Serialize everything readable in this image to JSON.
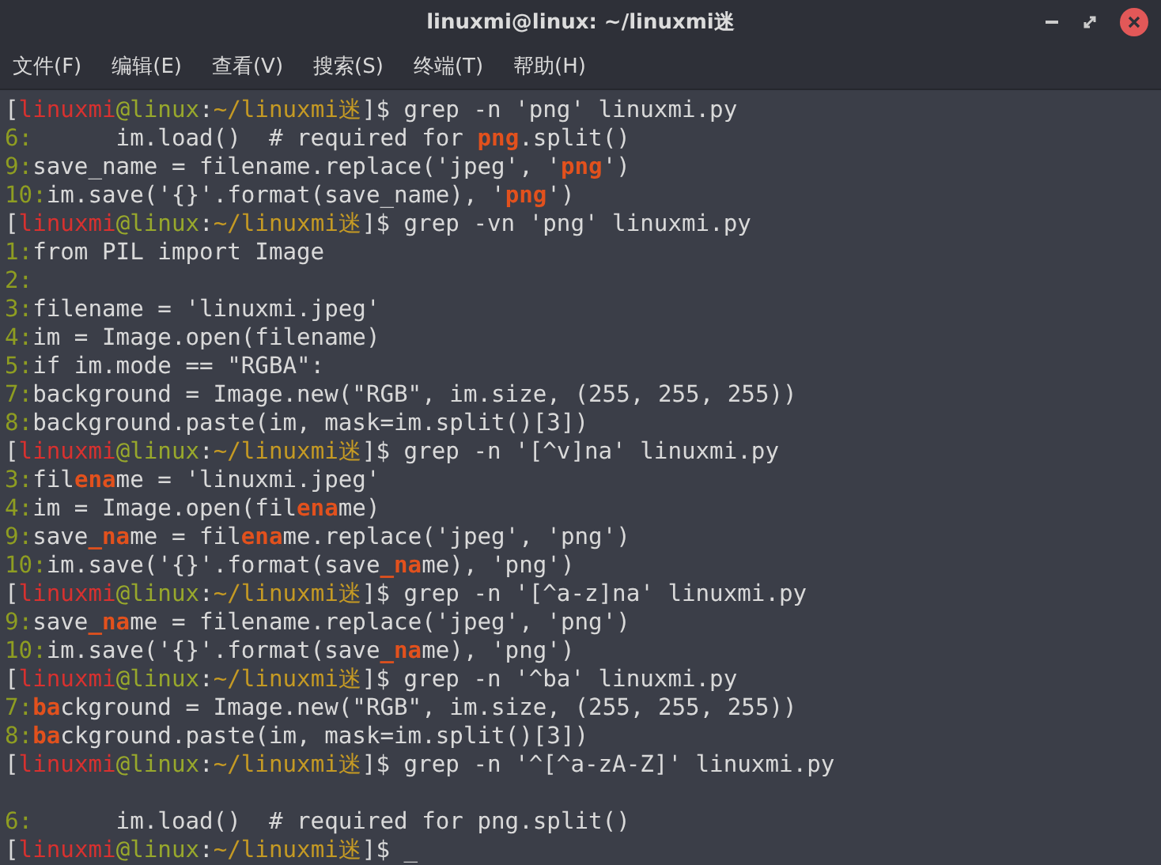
{
  "window": {
    "title": "linuxmi@linux: ~/linuxmi迷"
  },
  "menu": [
    "文件(F)",
    "编辑(E)",
    "查看(V)",
    "搜索(S)",
    "终端(T)",
    "帮助(H)"
  ],
  "terminal": {
    "lines": [
      {
        "segments": [
          {
            "kind": "punct",
            "text": "["
          },
          {
            "kind": "user",
            "text": "linuxmi"
          },
          {
            "kind": "host",
            "text": "@linux"
          },
          {
            "kind": "punct",
            "text": ":"
          },
          {
            "kind": "path",
            "text": "~/linuxmi迷"
          },
          {
            "kind": "plain",
            "text": "]$ grep -n 'png' linuxmi.py"
          }
        ]
      },
      {
        "segments": [
          {
            "kind": "lineno",
            "text": "6:"
          },
          {
            "kind": "plain",
            "text": "      im.load()  # required for "
          },
          {
            "kind": "match",
            "text": "png"
          },
          {
            "kind": "plain",
            "text": ".split()"
          }
        ]
      },
      {
        "segments": [
          {
            "kind": "lineno",
            "text": "9:"
          },
          {
            "kind": "plain",
            "text": "save_name = filename.replace('jpeg', '"
          },
          {
            "kind": "match",
            "text": "png"
          },
          {
            "kind": "plain",
            "text": "')"
          }
        ]
      },
      {
        "segments": [
          {
            "kind": "lineno",
            "text": "10:"
          },
          {
            "kind": "plain",
            "text": "im.save('{}'.format(save_name), '"
          },
          {
            "kind": "match",
            "text": "png"
          },
          {
            "kind": "plain",
            "text": "')"
          }
        ]
      },
      {
        "segments": [
          {
            "kind": "punct",
            "text": "["
          },
          {
            "kind": "user",
            "text": "linuxmi"
          },
          {
            "kind": "host",
            "text": "@linux"
          },
          {
            "kind": "punct",
            "text": ":"
          },
          {
            "kind": "path",
            "text": "~/linuxmi迷"
          },
          {
            "kind": "plain",
            "text": "]$ grep -vn 'png' linuxmi.py"
          }
        ]
      },
      {
        "segments": [
          {
            "kind": "lineno",
            "text": "1:"
          },
          {
            "kind": "plain",
            "text": "from PIL import Image"
          }
        ]
      },
      {
        "segments": [
          {
            "kind": "lineno",
            "text": "2:"
          }
        ]
      },
      {
        "segments": [
          {
            "kind": "lineno",
            "text": "3:"
          },
          {
            "kind": "plain",
            "text": "filename = 'linuxmi.jpeg'"
          }
        ]
      },
      {
        "segments": [
          {
            "kind": "lineno",
            "text": "4:"
          },
          {
            "kind": "plain",
            "text": "im = Image.open(filename)"
          }
        ]
      },
      {
        "segments": [
          {
            "kind": "lineno",
            "text": "5:"
          },
          {
            "kind": "plain",
            "text": "if im.mode == \"RGBA\":"
          }
        ]
      },
      {
        "segments": [
          {
            "kind": "lineno",
            "text": "7:"
          },
          {
            "kind": "plain",
            "text": "background = Image.new(\"RGB\", im.size, (255, 255, 255))"
          }
        ]
      },
      {
        "segments": [
          {
            "kind": "lineno",
            "text": "8:"
          },
          {
            "kind": "plain",
            "text": "background.paste(im, mask=im.split()[3])"
          }
        ]
      },
      {
        "segments": [
          {
            "kind": "punct",
            "text": "["
          },
          {
            "kind": "user",
            "text": "linuxmi"
          },
          {
            "kind": "host",
            "text": "@linux"
          },
          {
            "kind": "punct",
            "text": ":"
          },
          {
            "kind": "path",
            "text": "~/linuxmi迷"
          },
          {
            "kind": "plain",
            "text": "]$ grep -n '[^v]na' linuxmi.py"
          }
        ]
      },
      {
        "segments": [
          {
            "kind": "lineno",
            "text": "3:"
          },
          {
            "kind": "plain",
            "text": "fil"
          },
          {
            "kind": "match",
            "text": "ena"
          },
          {
            "kind": "plain",
            "text": "me = 'linuxmi.jpeg'"
          }
        ]
      },
      {
        "segments": [
          {
            "kind": "lineno",
            "text": "4:"
          },
          {
            "kind": "plain",
            "text": "im = Image.open(fil"
          },
          {
            "kind": "match",
            "text": "ena"
          },
          {
            "kind": "plain",
            "text": "me)"
          }
        ]
      },
      {
        "segments": [
          {
            "kind": "lineno",
            "text": "9:"
          },
          {
            "kind": "plain",
            "text": "save"
          },
          {
            "kind": "match",
            "text": "_na"
          },
          {
            "kind": "plain",
            "text": "me = fil"
          },
          {
            "kind": "match",
            "text": "ena"
          },
          {
            "kind": "plain",
            "text": "me.replace('jpeg', 'png')"
          }
        ]
      },
      {
        "segments": [
          {
            "kind": "lineno",
            "text": "10:"
          },
          {
            "kind": "plain",
            "text": "im.save('{}'.format(save"
          },
          {
            "kind": "match",
            "text": "_na"
          },
          {
            "kind": "plain",
            "text": "me), 'png')"
          }
        ]
      },
      {
        "segments": [
          {
            "kind": "punct",
            "text": "["
          },
          {
            "kind": "user",
            "text": "linuxmi"
          },
          {
            "kind": "host",
            "text": "@linux"
          },
          {
            "kind": "punct",
            "text": ":"
          },
          {
            "kind": "path",
            "text": "~/linuxmi迷"
          },
          {
            "kind": "plain",
            "text": "]$ grep -n '[^a-z]na' linuxmi.py"
          }
        ]
      },
      {
        "segments": [
          {
            "kind": "lineno",
            "text": "9:"
          },
          {
            "kind": "plain",
            "text": "save"
          },
          {
            "kind": "match",
            "text": "_na"
          },
          {
            "kind": "plain",
            "text": "me = filename.replace('jpeg', 'png')"
          }
        ]
      },
      {
        "segments": [
          {
            "kind": "lineno",
            "text": "10:"
          },
          {
            "kind": "plain",
            "text": "im.save('{}'.format(save"
          },
          {
            "kind": "match",
            "text": "_na"
          },
          {
            "kind": "plain",
            "text": "me), 'png')"
          }
        ]
      },
      {
        "segments": [
          {
            "kind": "punct",
            "text": "["
          },
          {
            "kind": "user",
            "text": "linuxmi"
          },
          {
            "kind": "host",
            "text": "@linux"
          },
          {
            "kind": "punct",
            "text": ":"
          },
          {
            "kind": "path",
            "text": "~/linuxmi迷"
          },
          {
            "kind": "plain",
            "text": "]$ grep -n '^ba' linuxmi.py"
          }
        ]
      },
      {
        "segments": [
          {
            "kind": "lineno",
            "text": "7:"
          },
          {
            "kind": "match",
            "text": "ba"
          },
          {
            "kind": "plain",
            "text": "ckground = Image.new(\"RGB\", im.size, (255, 255, 255))"
          }
        ]
      },
      {
        "segments": [
          {
            "kind": "lineno",
            "text": "8:"
          },
          {
            "kind": "match",
            "text": "ba"
          },
          {
            "kind": "plain",
            "text": "ckground.paste(im, mask=im.split()[3])"
          }
        ]
      },
      {
        "segments": [
          {
            "kind": "punct",
            "text": "["
          },
          {
            "kind": "user",
            "text": "linuxmi"
          },
          {
            "kind": "host",
            "text": "@linux"
          },
          {
            "kind": "punct",
            "text": ":"
          },
          {
            "kind": "path",
            "text": "~/linuxmi迷"
          },
          {
            "kind": "plain",
            "text": "]$ grep -n '^[^a-zA-Z]' linuxmi.py"
          }
        ]
      },
      {
        "kind": "blank"
      },
      {
        "segments": [
          {
            "kind": "lineno",
            "text": "6:"
          },
          {
            "kind": "plain",
            "text": "      im.load()  # required for png.split()"
          }
        ]
      },
      {
        "segments": [
          {
            "kind": "punct",
            "text": "["
          },
          {
            "kind": "user",
            "text": "linuxmi"
          },
          {
            "kind": "host",
            "text": "@linux"
          },
          {
            "kind": "punct",
            "text": ":"
          },
          {
            "kind": "path",
            "text": "~/linuxmi迷"
          },
          {
            "kind": "plain",
            "text": "]$ "
          },
          {
            "kind": "cursor",
            "text": "_"
          }
        ]
      }
    ]
  }
}
